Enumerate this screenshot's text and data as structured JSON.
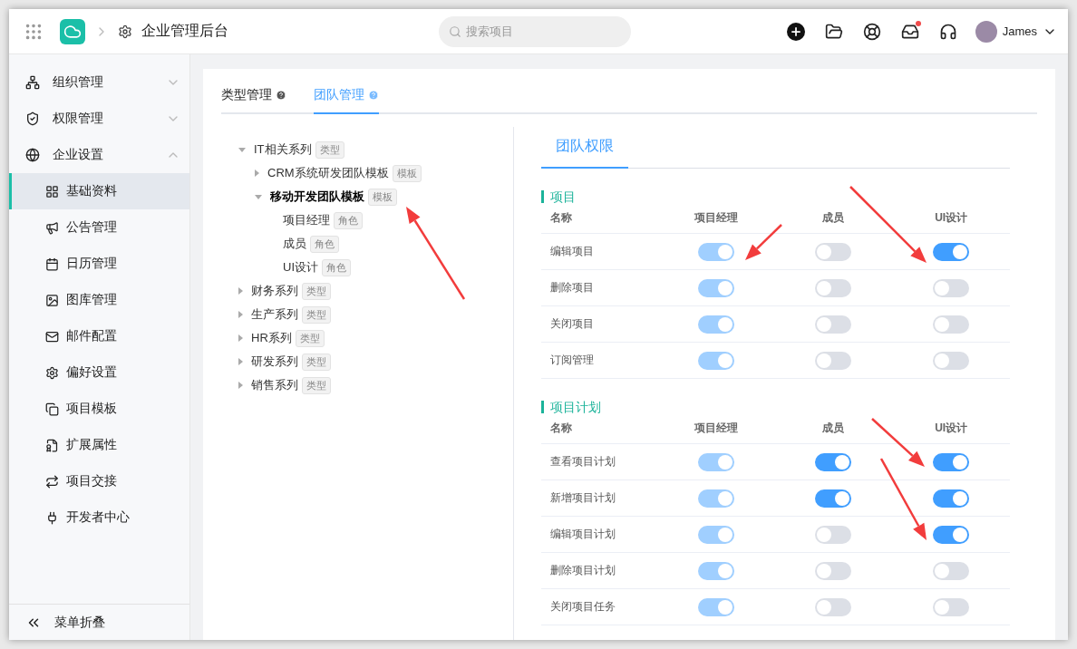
{
  "header": {
    "app_title": "企业管理后台",
    "search": {
      "placeholder": "搜索项目"
    },
    "has_notification": true,
    "user": {
      "name": "James"
    }
  },
  "sidebar": {
    "items": [
      {
        "label": "组织管理",
        "expanded": false
      },
      {
        "label": "权限管理",
        "expanded": false
      },
      {
        "label": "企业设置",
        "expanded": true,
        "children": [
          {
            "label": "基础资料",
            "selected": true
          },
          {
            "label": "公告管理",
            "selected": false
          },
          {
            "label": "日历管理",
            "selected": false
          },
          {
            "label": "图库管理",
            "selected": false
          },
          {
            "label": "邮件配置",
            "selected": false
          },
          {
            "label": "偏好设置",
            "selected": false
          },
          {
            "label": "项目模板",
            "selected": false
          },
          {
            "label": "扩展属性",
            "selected": false
          },
          {
            "label": "项目交接",
            "selected": false
          },
          {
            "label": "开发者中心",
            "selected": false
          }
        ]
      }
    ],
    "collapse_label": "菜单折叠"
  },
  "tabs": [
    {
      "label": "类型管理",
      "selected": false
    },
    {
      "label": "团队管理",
      "selected": true
    }
  ],
  "tree": [
    {
      "label": "IT相关系列",
      "tag": "类型",
      "expanded": true,
      "selected": false,
      "children": [
        {
          "label": "CRM系统研发团队模板",
          "tag": "模板",
          "expanded": false,
          "selected": false
        },
        {
          "label": "移动开发团队模板",
          "tag": "模板",
          "expanded": true,
          "selected": true,
          "children": [
            {
              "label": "项目经理",
              "tag": "角色",
              "selected": false
            },
            {
              "label": "成员",
              "tag": "角色",
              "selected": false
            },
            {
              "label": "UI设计",
              "tag": "角色",
              "selected": false
            }
          ]
        }
      ]
    },
    {
      "label": "财务系列",
      "tag": "类型",
      "expanded": false,
      "selected": false
    },
    {
      "label": "生产系列",
      "tag": "类型",
      "expanded": false,
      "selected": false
    },
    {
      "label": "HR系列",
      "tag": "类型",
      "expanded": false,
      "selected": false
    },
    {
      "label": "研发系列",
      "tag": "类型",
      "expanded": false,
      "selected": false
    },
    {
      "label": "销售系列",
      "tag": "类型",
      "expanded": false,
      "selected": false
    }
  ],
  "permissions": {
    "tab": {
      "label": "团队权限",
      "selected": true
    },
    "sections": [
      {
        "title": "项目",
        "columns": [
          "名称",
          "项目经理",
          "成员",
          "UI设计"
        ],
        "rows": [
          {
            "name": "编辑项目",
            "toggles": [
              {
                "on": true,
                "disabled": true
              },
              {
                "on": false,
                "disabled": false
              },
              {
                "on": true,
                "disabled": false
              }
            ]
          },
          {
            "name": "删除项目",
            "toggles": [
              {
                "on": true,
                "disabled": true
              },
              {
                "on": false,
                "disabled": false
              },
              {
                "on": false,
                "disabled": false
              }
            ]
          },
          {
            "name": "关闭项目",
            "toggles": [
              {
                "on": true,
                "disabled": true
              },
              {
                "on": false,
                "disabled": false
              },
              {
                "on": false,
                "disabled": false
              }
            ]
          },
          {
            "name": "订阅管理",
            "toggles": [
              {
                "on": true,
                "disabled": true
              },
              {
                "on": false,
                "disabled": false
              },
              {
                "on": false,
                "disabled": false
              }
            ]
          }
        ]
      },
      {
        "title": "项目计划",
        "columns": [
          "名称",
          "项目经理",
          "成员",
          "UI设计"
        ],
        "rows": [
          {
            "name": "查看项目计划",
            "toggles": [
              {
                "on": true,
                "disabled": true
              },
              {
                "on": true,
                "disabled": false
              },
              {
                "on": true,
                "disabled": false
              }
            ]
          },
          {
            "name": "新增项目计划",
            "toggles": [
              {
                "on": true,
                "disabled": true
              },
              {
                "on": true,
                "disabled": false
              },
              {
                "on": true,
                "disabled": false
              }
            ]
          },
          {
            "name": "编辑项目计划",
            "toggles": [
              {
                "on": true,
                "disabled": true
              },
              {
                "on": false,
                "disabled": false
              },
              {
                "on": true,
                "disabled": false
              }
            ]
          },
          {
            "name": "删除项目计划",
            "toggles": [
              {
                "on": true,
                "disabled": true
              },
              {
                "on": false,
                "disabled": false
              },
              {
                "on": false,
                "disabled": false
              }
            ]
          },
          {
            "name": "关闭项目任务",
            "toggles": [
              {
                "on": true,
                "disabled": true
              },
              {
                "on": false,
                "disabled": false
              },
              {
                "on": false,
                "disabled": false
              }
            ]
          }
        ]
      }
    ]
  }
}
